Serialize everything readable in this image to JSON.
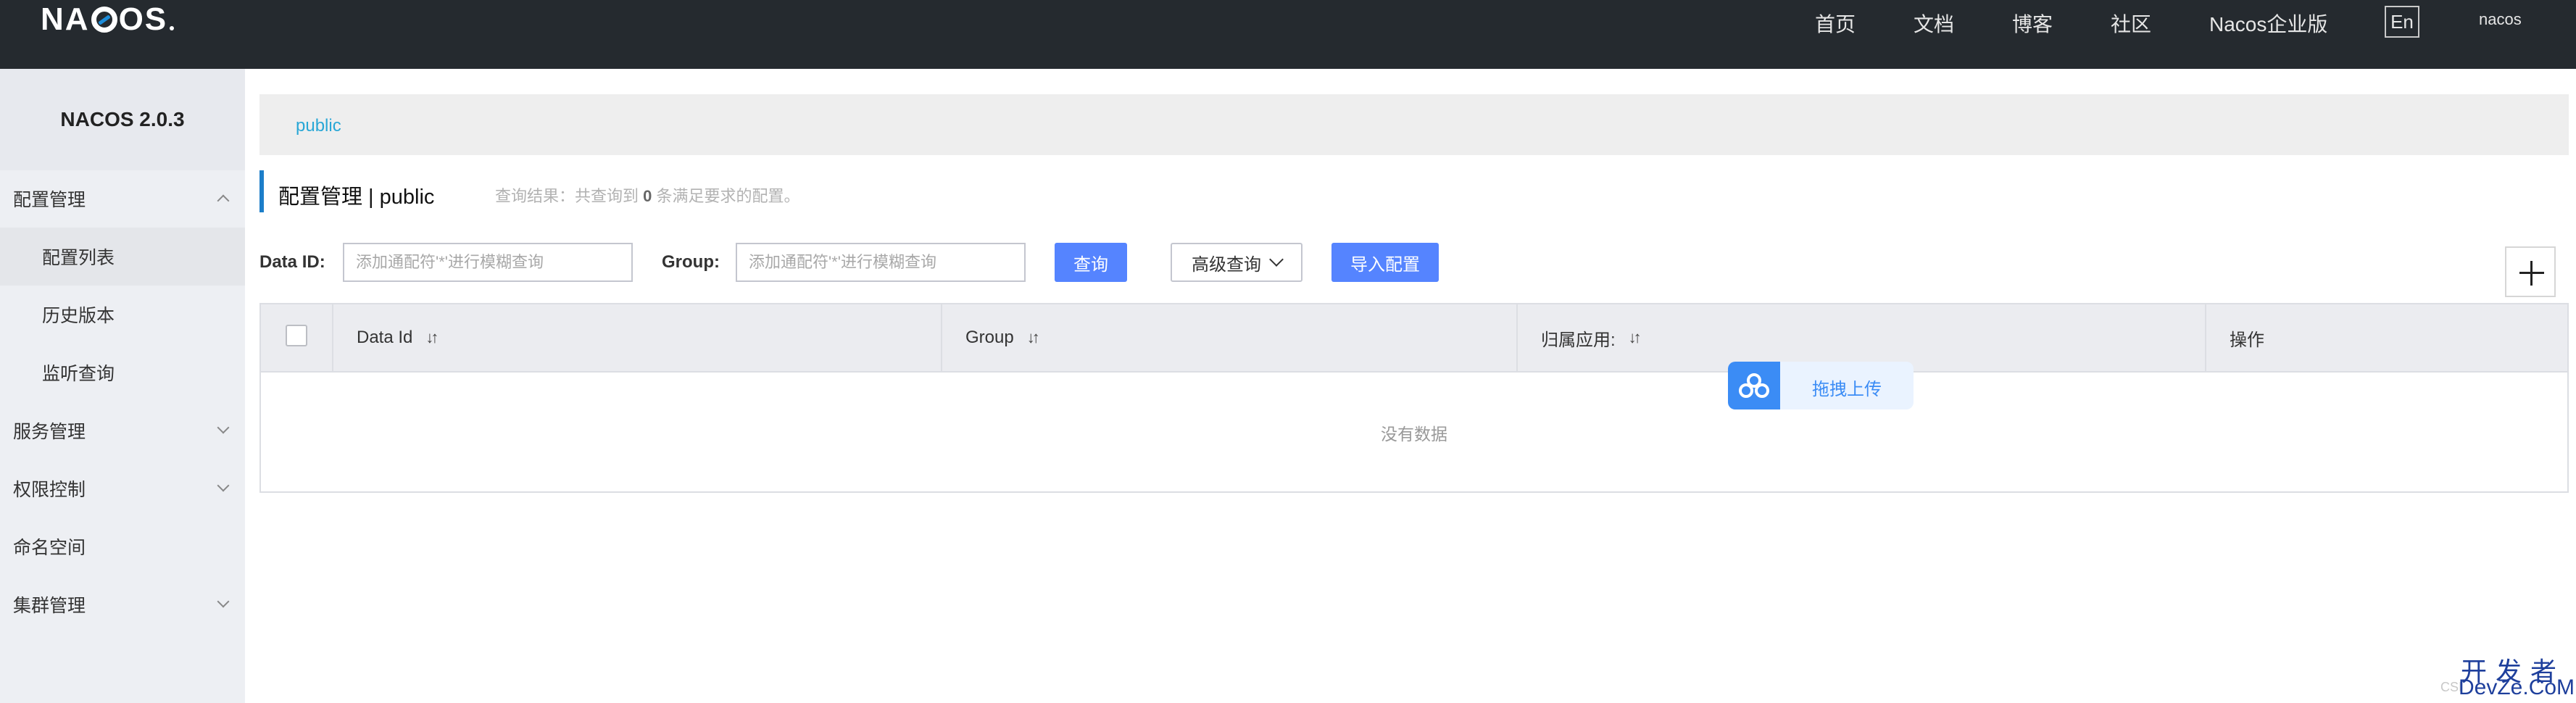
{
  "header": {
    "logo": "NACOS",
    "nav": [
      "首页",
      "文档",
      "博客",
      "社区",
      "Nacos企业版"
    ],
    "lang": "En",
    "user": "nacos"
  },
  "sidebar": {
    "version": "NACOS 2.0.3",
    "groups": [
      {
        "label": "配置管理",
        "expanded": true,
        "items": [
          {
            "label": "配置列表",
            "active": true
          },
          {
            "label": "历史版本"
          },
          {
            "label": "监听查询"
          }
        ]
      },
      {
        "label": "服务管理",
        "expanded": false
      },
      {
        "label": "权限控制",
        "expanded": false
      },
      {
        "label": "命名空间"
      },
      {
        "label": "集群管理",
        "expanded": false
      }
    ]
  },
  "main": {
    "namespace_tab": "public",
    "title": "配置管理  |  public",
    "result_prefix": "查询结果：共查询到",
    "result_count": "0",
    "result_suffix": "条满足要求的配置。",
    "search": {
      "data_id_label": "Data ID:",
      "data_id_placeholder": "添加通配符'*'进行模糊查询",
      "group_label": "Group:",
      "group_placeholder": "添加通配符'*'进行模糊查询",
      "query_button": "查询",
      "advanced_button": "高级查询",
      "import_button": "导入配置"
    },
    "table": {
      "columns": [
        "Data Id",
        "Group",
        "归属应用:",
        "操作"
      ],
      "empty_text": "没有数据"
    },
    "upload_widget": "拖拽上传"
  },
  "watermark": {
    "line1": "开发者",
    "line2": "DevZe.CoM",
    "small": "CSI"
  },
  "colors": {
    "topbar": "#252a2f",
    "primary": "#5584ff",
    "link": "#29a7d6",
    "accent_bar": "#1c7ec9"
  }
}
